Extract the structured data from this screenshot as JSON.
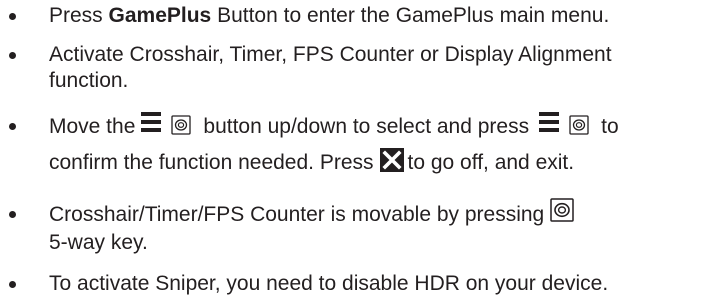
{
  "items": [
    {
      "prefix": "Press ",
      "bold": "GamePlus",
      "suffix": " Button to enter the GamePlus main menu."
    },
    {
      "line1": "Activate Crosshair, Timer, FPS Counter or Display Alignment",
      "line2": "function."
    },
    {
      "a": "Move the",
      "b": "button up/down to select and press",
      "c": "to",
      "d": "confirm the function needed. Press",
      "e": "to go off, and exit."
    },
    {
      "line1": "Crosshair/Timer/FPS Counter is movable by pressing",
      "line2": "5-way key."
    },
    {
      "line1": "To activate Sniper, you need to disable HDR on your device."
    }
  ],
  "icons": {
    "menu": "menu-icon",
    "joystick": "five-way-key-icon",
    "close": "close-icon"
  }
}
